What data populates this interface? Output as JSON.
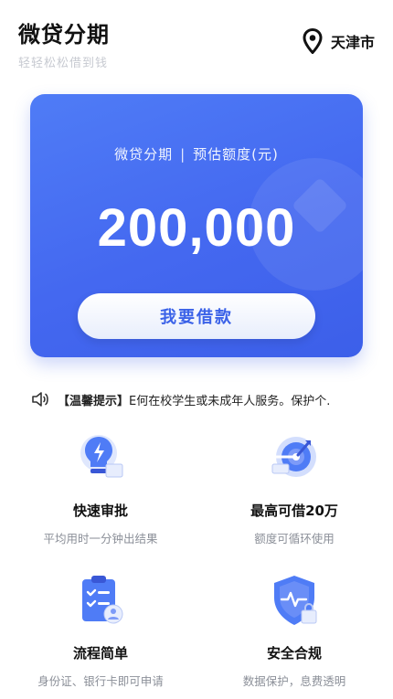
{
  "header": {
    "title": "微贷分期",
    "subtitle": "轻轻松松借到钱",
    "location": "天津市",
    "location_icon": "map-pin-icon"
  },
  "card": {
    "caption_left": "微贷分期",
    "caption_separator": "|",
    "caption_right": "预估额度(元)",
    "amount": "200,000",
    "button_label": "我要借款",
    "accent_color": "#4468f0"
  },
  "notice": {
    "icon": "speaker-icon",
    "tag": "【温馨提示】",
    "text": "E何在校学生或未成年人服务。保护个."
  },
  "features": [
    {
      "title": "快速审批",
      "desc": "平均用时一分钟出结果",
      "icon": "lightbulb-icon"
    },
    {
      "title": "最高可借20万",
      "desc": "额度可循环使用",
      "icon": "target-icon"
    },
    {
      "title": "流程简单",
      "desc": "身份证、银行卡即可申请",
      "icon": "checklist-icon"
    },
    {
      "title": "安全合规",
      "desc": "数据保护，息费透明",
      "icon": "shield-icon"
    }
  ]
}
